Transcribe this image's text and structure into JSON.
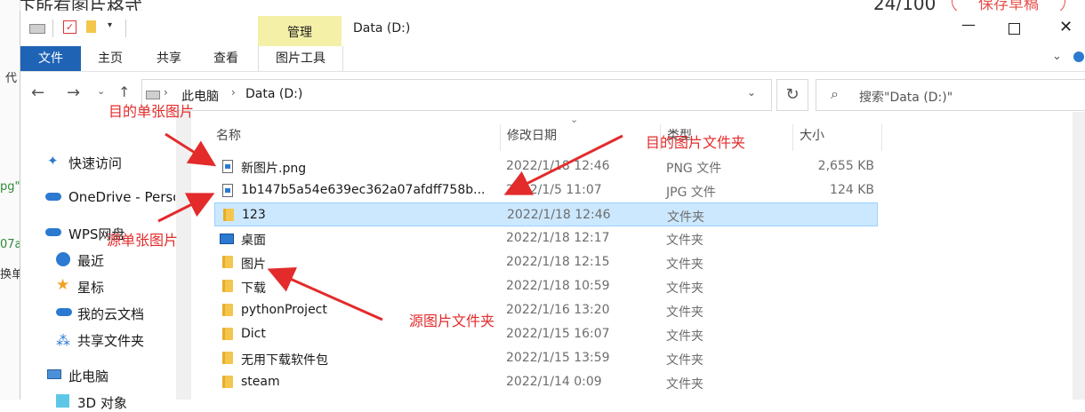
{
  "background": {
    "title": "夹下所有图片格式",
    "count": "24/100",
    "save_draft": "保存草稿",
    "frag1": "代",
    "frag2": "pg\"",
    "frag3": "07a",
    "frag4": "换单"
  },
  "window": {
    "title": "Data (D:)",
    "tabs": {
      "file": "文件",
      "home": "主页",
      "share": "共享",
      "view": "查看",
      "manage": "管理",
      "picture_tools": "图片工具"
    },
    "breadcrumb": [
      "此电脑",
      "Data (D:)"
    ],
    "search_placeholder": "搜索\"Data (D:)\""
  },
  "nav": {
    "quick_access": "快速访问",
    "onedrive": "OneDrive - Perso",
    "wps": "WPS网盘",
    "recent": "最近",
    "star": "星标",
    "cloud": "我的云文档",
    "shared": "共享文件夹",
    "this_pc": "此电脑",
    "objects3d": "3D 对象"
  },
  "columns": {
    "name": "名称",
    "date": "修改日期",
    "type": "类型",
    "size": "大小"
  },
  "files": [
    {
      "name": "新图片.png",
      "date": "2022/1/18 12:46",
      "type": "PNG 文件",
      "size": "2,655 KB",
      "icon": "image-file-icon"
    },
    {
      "name": "1b147b5a54e639ec362a07afdff758b...",
      "date": "2022/1/5 11:07",
      "type": "JPG 文件",
      "size": "124 KB",
      "icon": "image-file-icon"
    },
    {
      "name": "123",
      "date": "2022/1/18 12:46",
      "type": "文件夹",
      "size": "",
      "icon": "folder-icon"
    },
    {
      "name": "桌面",
      "date": "2022/1/18 12:17",
      "type": "文件夹",
      "size": "",
      "icon": "desktop-icon"
    },
    {
      "name": "图片",
      "date": "2022/1/18 12:15",
      "type": "文件夹",
      "size": "",
      "icon": "folder-icon"
    },
    {
      "name": "下载",
      "date": "2022/1/18 10:59",
      "type": "文件夹",
      "size": "",
      "icon": "folder-icon"
    },
    {
      "name": "pythonProject",
      "date": "2022/1/16 13:20",
      "type": "文件夹",
      "size": "",
      "icon": "folder-icon"
    },
    {
      "name": "Dict",
      "date": "2022/1/15 16:07",
      "type": "文件夹",
      "size": "",
      "icon": "folder-icon"
    },
    {
      "name": "无用下载软件包",
      "date": "2022/1/15 13:59",
      "type": "文件夹",
      "size": "",
      "icon": "folder-icon"
    },
    {
      "name": "steam",
      "date": "2022/1/14 0:09",
      "type": "文件夹",
      "size": "",
      "icon": "folder-icon"
    }
  ],
  "annotations": {
    "target_single": "目的单张图片",
    "target_folder": "目的图片文件夹",
    "source_single": "源单张图片",
    "source_folder": "源图片文件夹",
    "color": "#e32b2b"
  }
}
